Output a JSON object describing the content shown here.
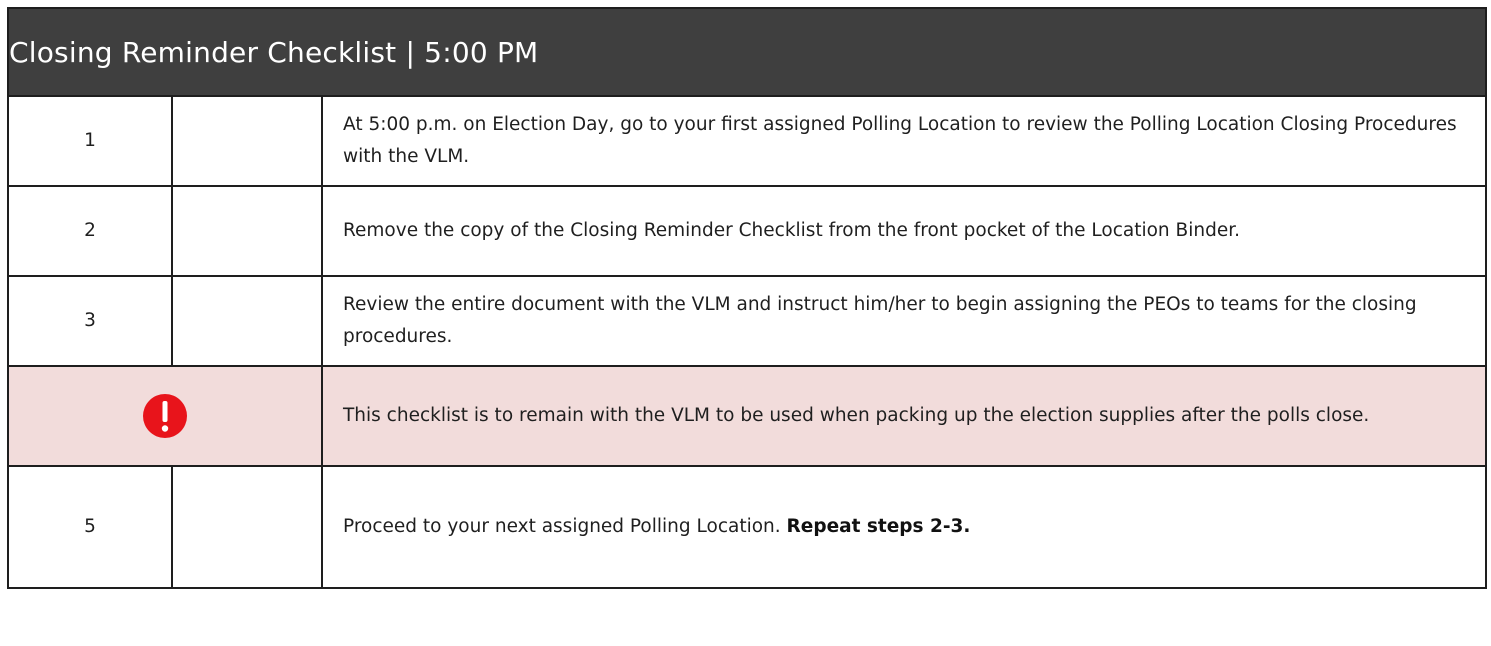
{
  "title": "Closing Reminder Checklist | 5:00 PM",
  "steps": [
    {
      "number": "1",
      "text": "At 5:00 p.m. on Election Day, go to your first assigned Polling Location to review the Polling Location Closing Procedures with the VLM."
    },
    {
      "number": "2",
      "text": "Remove the copy of the Closing Reminder Checklist from the front pocket of the Location Binder."
    },
    {
      "number": "3",
      "text": "Review the entire document with the VLM and instruct him/her to begin assigning the PEOs to teams for the closing procedures."
    }
  ],
  "alert": {
    "icon": "exclamation-alert-icon",
    "text": "This checklist is to remain with the VLM to be used when packing up the election supplies after the polls close.",
    "background_color": "#f2dcdb",
    "icon_color": "#e8141b"
  },
  "final_step": {
    "number": "5",
    "text": "Proceed to your next assigned Polling Location. ",
    "emphasis": "Repeat steps 2-3."
  },
  "colors": {
    "header_background": "#3f3f3f",
    "header_text": "#ffffff",
    "border": "#1e1e1e"
  }
}
